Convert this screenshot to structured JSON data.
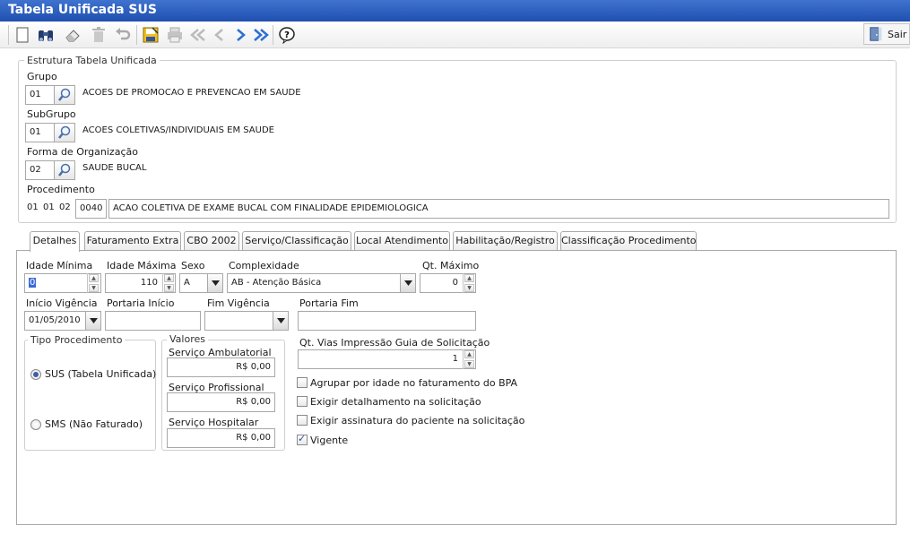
{
  "window": {
    "title": "Tabela Unificada SUS"
  },
  "toolbar": {
    "exit_label": "Sair",
    "icons": [
      "new-icon",
      "search-binoculars-icon",
      "eraser-icon",
      "delete-trash-icon",
      "undo-icon",
      "save-icon",
      "print-icon",
      "first-record-icon",
      "previous-record-icon",
      "next-record-icon",
      "last-record-icon",
      "help-icon",
      "exit-door-icon"
    ]
  },
  "estrutura": {
    "legend": "Estrutura Tabela Unificada",
    "grupo": {
      "label": "Grupo",
      "code": "01",
      "desc": "ACOES DE PROMOCAO E PREVENCAO EM SAUDE"
    },
    "subgrupo": {
      "label": "SubGrupo",
      "code": "01",
      "desc": "ACOES COLETIVAS/INDIVIDUAIS EM SAUDE"
    },
    "forma": {
      "label": "Forma de Organização",
      "code": "02",
      "desc": "SAUDE BUCAL"
    },
    "procedimento": {
      "label": "Procedimento",
      "prefix": [
        "01",
        "01",
        "02"
      ],
      "code": "0040",
      "desc": "ACAO COLETIVA DE EXAME BUCAL COM FINALIDADE EPIDEMIOLOGICA"
    }
  },
  "tabs": [
    {
      "label": "Detalhes",
      "active": true
    },
    {
      "label": "Faturamento Extra"
    },
    {
      "label": "CBO 2002"
    },
    {
      "label": "Serviço/Classificação"
    },
    {
      "label": "Local Atendimento"
    },
    {
      "label": "Habilitação/Registro"
    },
    {
      "label": "Classificação Procedimento"
    }
  ],
  "detalhes": {
    "idade_minima": {
      "label": "Idade Mínima",
      "value": "0"
    },
    "idade_maxima": {
      "label": "Idade Máxima",
      "value": "110"
    },
    "sexo": {
      "label": "Sexo",
      "value": "A"
    },
    "complexidade": {
      "label": "Complexidade",
      "value": "AB - Atenção Básica"
    },
    "qt_maximo": {
      "label": "Qt. Máximo",
      "value": "0"
    },
    "inicio_vigencia": {
      "label": "Início Vigência",
      "value": "01/05/2010"
    },
    "portaria_inicio": {
      "label": "Portaria Início",
      "value": ""
    },
    "fim_vigencia": {
      "label": "Fim Vigência",
      "value": ""
    },
    "portaria_fim": {
      "label": "Portaria Fim",
      "value": ""
    },
    "tipo_procedimento": {
      "legend": "Tipo Procedimento",
      "options": [
        {
          "label": "SUS (Tabela Unificada)",
          "selected": true
        },
        {
          "label": "SMS (Não Faturado)",
          "selected": false
        }
      ]
    },
    "valores": {
      "legend": "Valores",
      "ambulatorial": {
        "label": "Serviço Ambulatorial",
        "value": "R$ 0,00"
      },
      "profissional": {
        "label": "Serviço Profissional",
        "value": "R$ 0,00"
      },
      "hospitalar": {
        "label": "Serviço Hospitalar",
        "value": "R$ 0,00"
      }
    },
    "qt_vias": {
      "label": "Qt. Vias Impressão Guia de Solicitação",
      "value": "1"
    },
    "checkboxes": [
      {
        "label": "Agrupar por idade no faturamento do BPA",
        "checked": false
      },
      {
        "label": "Exigir detalhamento na solicitação",
        "checked": false
      },
      {
        "label": "Exigir assinatura do paciente na solicitação",
        "checked": false
      },
      {
        "label": "Vigente",
        "checked": true
      }
    ]
  }
}
